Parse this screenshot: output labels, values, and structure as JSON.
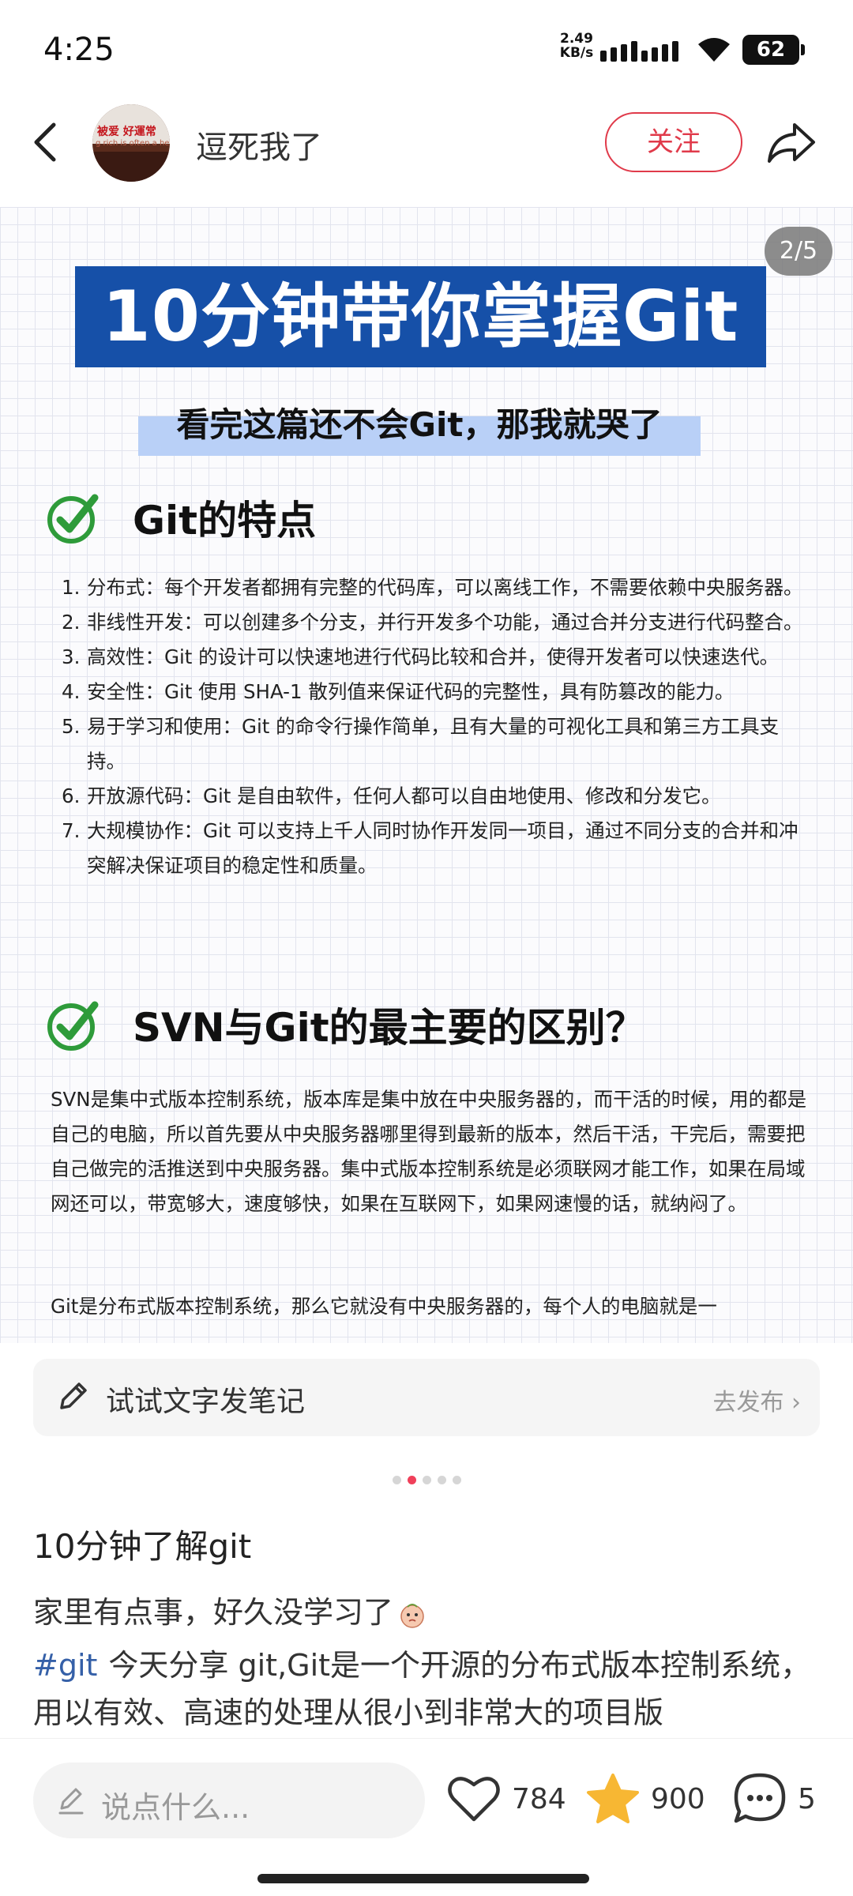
{
  "status_bar": {
    "time": "4:25",
    "network_speed_value": "2.49",
    "network_speed_unit": "KB/s",
    "battery": "62"
  },
  "header": {
    "username": "逗死我了",
    "follow_label": "关注",
    "avatar_text_line1": "被爱 好運常",
    "avatar_text_line2": "g rich is often a he"
  },
  "post_image": {
    "page_indicator": "2/5",
    "title": "10分钟带你掌握Git",
    "subtitle": "看完这篇还不会Git，那我就哭了",
    "section1_title": "Git的特点",
    "features": [
      {
        "num": "1.",
        "text": "分布式：每个开发者都拥有完整的代码库，可以离线工作，不需要依赖中央服务器。"
      },
      {
        "num": "2.",
        "text": "非线性开发：可以创建多个分支，并行开发多个功能，通过合并分支进行代码整合。"
      },
      {
        "num": "3.",
        "text": "高效性：Git 的设计可以快速地进行代码比较和合并，使得开发者可以快速迭代。"
      },
      {
        "num": "4.",
        "text": "安全性：Git 使用 SHA-1 散列值来保证代码的完整性，具有防篡改的能力。"
      },
      {
        "num": "5.",
        "text": "易于学习和使用：Git 的命令行操作简单，且有大量的可视化工具和第三方工具支持。"
      },
      {
        "num": "6.",
        "text": "开放源代码：Git 是自由软件，任何人都可以自由地使用、修改和分发它。"
      },
      {
        "num": "7.",
        "text": "大规模协作：Git 可以支持上千人同时协作开发同一项目，通过不同分支的合并和冲突解决保证项目的稳定性和质量。"
      }
    ],
    "section2_title": "SVN与Git的最主要的区别？",
    "paragraph1": "SVN是集中式版本控制系统，版本库是集中放在中央服务器的，而干活的时候，用的都是自己的电脑，所以首先要从中央服务器哪里得到最新的版本，然后干活，干完后，需要把自己做完的活推送到中央服务器。集中式版本控制系统是必须联网才能工作，如果在局域网还可以，带宽够大，速度够快，如果在互联网下，如果网速慢的话，就纳闷了。",
    "paragraph2": "Git是分布式版本控制系统，那么它就没有中央服务器的，每个人的电脑就是一"
  },
  "note_bar": {
    "text": "试试文字发笔记",
    "publish_label": "去发布 ›"
  },
  "post": {
    "title": "10分钟了解git",
    "line1": "家里有点事，好久没学习了",
    "hashtag": "#git",
    "line2": "今天分享 git,Git是一个开源的分布式版本控制系统，用以有效、高速的处理从很小到非常大的项目版"
  },
  "bottom_bar": {
    "comment_placeholder": "说点什么...",
    "likes": "784",
    "favorites": "900",
    "comments": "5"
  },
  "colors": {
    "accent_red": "#e03a4a",
    "banner_blue": "#1650a8",
    "check_green": "#2e9b3a",
    "star_yellow": "#f7b733"
  }
}
